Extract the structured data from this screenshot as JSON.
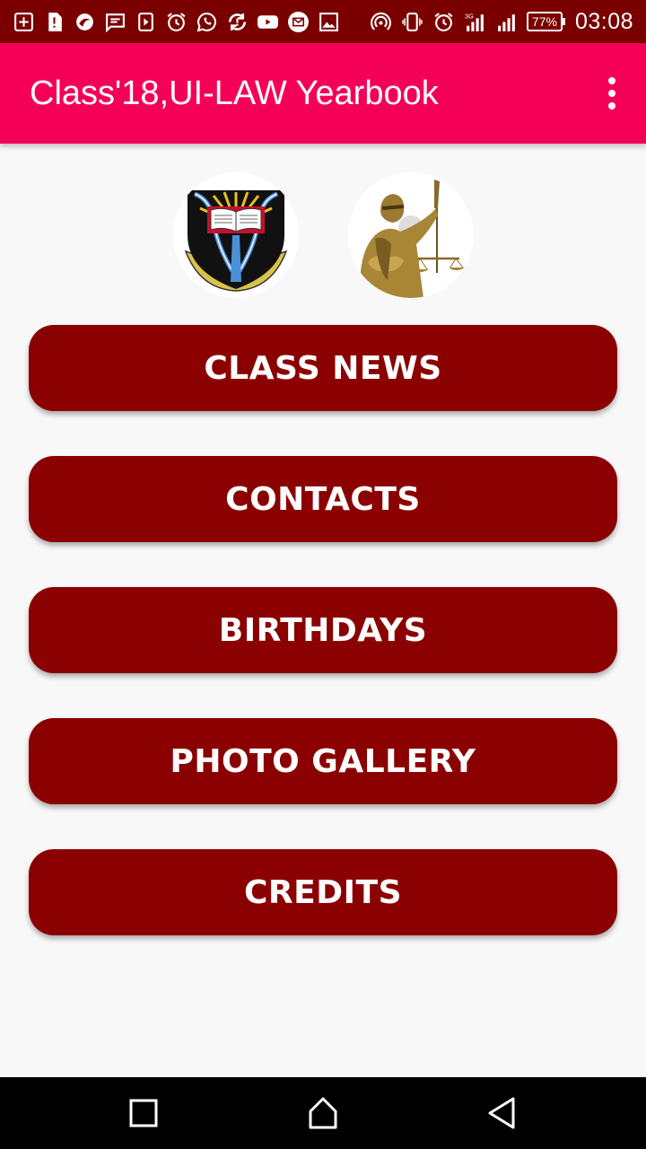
{
  "status_bar": {
    "left_icons": [
      "add-box-icon",
      "sim-alert-icon",
      "bird-app-icon",
      "message-icon",
      "play-store-icon",
      "alarm-icon",
      "whatsapp-icon",
      "sync-alert-icon",
      "youtube-icon",
      "mail-icon",
      "image-icon"
    ],
    "right_icons": [
      "hotspot-icon",
      "vibrate-icon",
      "alarm-icon",
      "signal-3g-icon",
      "signal-icon"
    ],
    "battery": "77%",
    "time": "03:08"
  },
  "app_bar": {
    "title": "Class'18,UI-LAW Yearbook",
    "color": "#f50057"
  },
  "logos": {
    "left": "university-crest",
    "right": "lady-justice"
  },
  "menu": {
    "button_color": "#8b0000",
    "items": [
      {
        "label": "CLASS NEWS"
      },
      {
        "label": "CONTACTS"
      },
      {
        "label": "BIRTHDAYS"
      },
      {
        "label": "PHOTO GALLERY"
      },
      {
        "label": "CREDITS"
      }
    ]
  },
  "nav_bar": {
    "buttons": [
      "recents",
      "home",
      "back"
    ]
  }
}
